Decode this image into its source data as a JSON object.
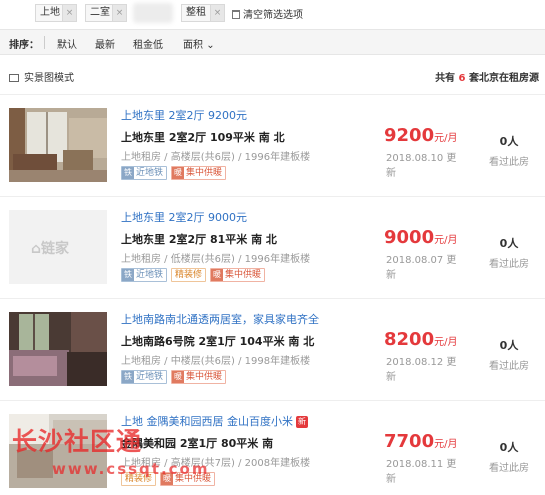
{
  "filters": {
    "tags": [
      "上地",
      "二室",
      "整租"
    ],
    "close_glyph": "×",
    "clear_label": "清空筛选选项"
  },
  "sort": {
    "label": "排序：",
    "options": [
      "默认",
      "最新",
      "租金低",
      "面积"
    ],
    "dropdown_glyph": "⌄"
  },
  "view": {
    "mode_label": "实景图模式",
    "total_prefix": "共有",
    "total_count": "6",
    "total_suffix": "套北京在租房源"
  },
  "placeholder_logo": "⌂链家",
  "listings": [
    {
      "title": "上地东里 2室2厅 9200元",
      "address": "上地东里  2室2厅  109平米  南 北",
      "meta": "上地租房 / 高楼层(共6层) / 1996年建板楼",
      "tags": [
        {
          "text": "近地铁",
          "icon": "铁",
          "style": "blue"
        },
        {
          "text": "集中供暖",
          "icon": "暖",
          "style": "red"
        }
      ],
      "price": "9200",
      "price_unit": "元/月",
      "date": "2018.08.10 更新",
      "views_count": "0人",
      "views_label": "看过此房"
    },
    {
      "title": "上地东里 2室2厅 9000元",
      "address": "上地东里  2室2厅  81平米  南 北",
      "meta": "上地租房 / 低楼层(共6层) / 1996年建板楼",
      "tags": [
        {
          "text": "近地铁",
          "icon": "铁",
          "style": "blue"
        },
        {
          "text": "精装修",
          "icon": "",
          "style": "orange"
        },
        {
          "text": "集中供暖",
          "icon": "暖",
          "style": "red"
        }
      ],
      "price": "9000",
      "price_unit": "元/月",
      "date": "2018.08.07 更新",
      "views_count": "0人",
      "views_label": "看过此房"
    },
    {
      "title": "上地南路南北通透两居室，家具家电齐全",
      "address": "上地南路6号院  2室1厅  104平米  南 北",
      "meta": "上地租房 / 中楼层(共6层) / 1998年建板楼",
      "tags": [
        {
          "text": "近地铁",
          "icon": "铁",
          "style": "blue"
        },
        {
          "text": "集中供暖",
          "icon": "暖",
          "style": "red"
        }
      ],
      "price": "8200",
      "price_unit": "元/月",
      "date": "2018.08.12 更新",
      "views_count": "0人",
      "views_label": "看过此房"
    },
    {
      "title": "上地 金隅美和园西居 金山百度小米",
      "new_badge": "新",
      "address": "金隅美和园  2室1厅  80平米  南",
      "meta": "上地租房 / 高楼层(共7层) / 2008年建板楼",
      "tags": [
        {
          "text": "精装修",
          "icon": "",
          "style": "orange"
        },
        {
          "text": "集中供暖",
          "icon": "暖",
          "style": "red"
        }
      ],
      "price": "7700",
      "price_unit": "元/月",
      "date": "2018.08.11 更新",
      "views_count": "0人",
      "views_label": "看过此房"
    }
  ],
  "watermark": {
    "big": "长沙社区通",
    "url": "www.cssqt.com"
  }
}
